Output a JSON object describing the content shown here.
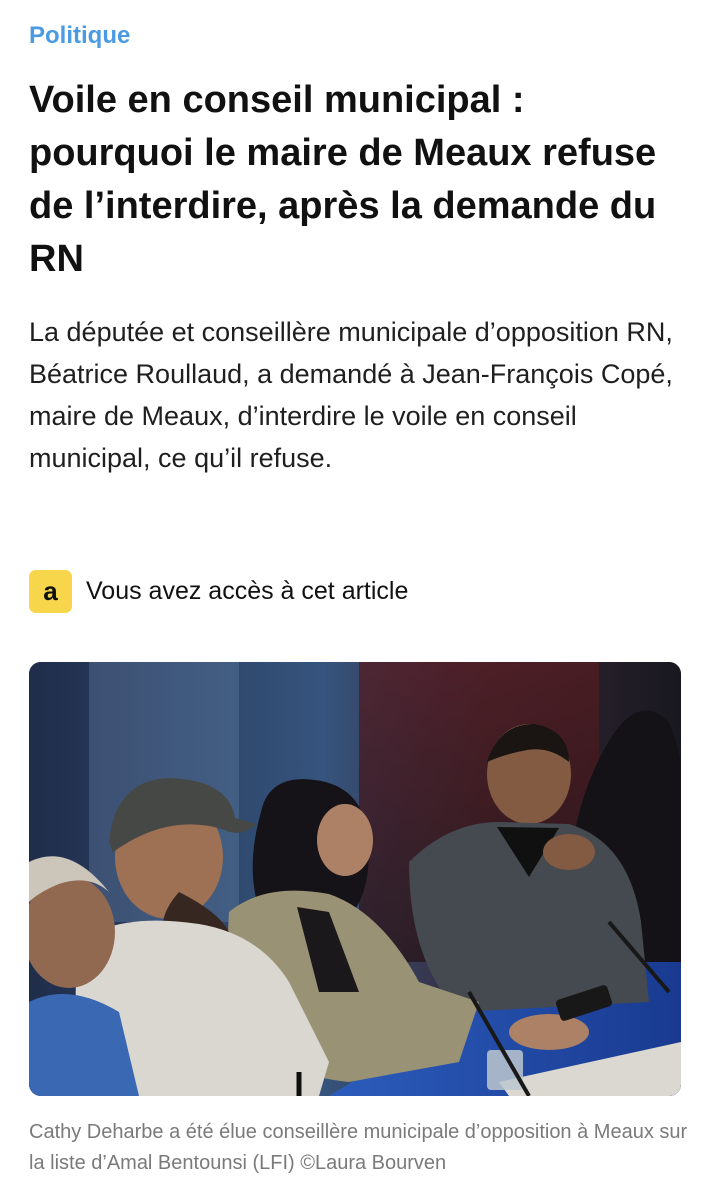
{
  "article": {
    "category": "Politique",
    "headline": "Voile en conseil municipal : pourquoi le maire de Meaux refuse de l’interdire, après la demande du RN",
    "lede": "La députée et conseillère municipale d’opposition RN, Béatrice Roullaud, a demandé à Jean-François Copé, maire de Meaux, d’interdire le voile en conseil municipal, ce qu’il refuse.",
    "access": {
      "badge_letter": "a",
      "text": "Vous avez accès à cet article",
      "badge_color": "#f8d64c"
    },
    "photo": {
      "caption": "Cathy Deharbe a été élue conseillère municipale d’opposition à Meaux sur la liste d’Amal Bentounsi (LFI) ©Laura Bourven"
    }
  },
  "colors": {
    "category": "#4a9ae4",
    "caption": "#7a7a7a"
  }
}
